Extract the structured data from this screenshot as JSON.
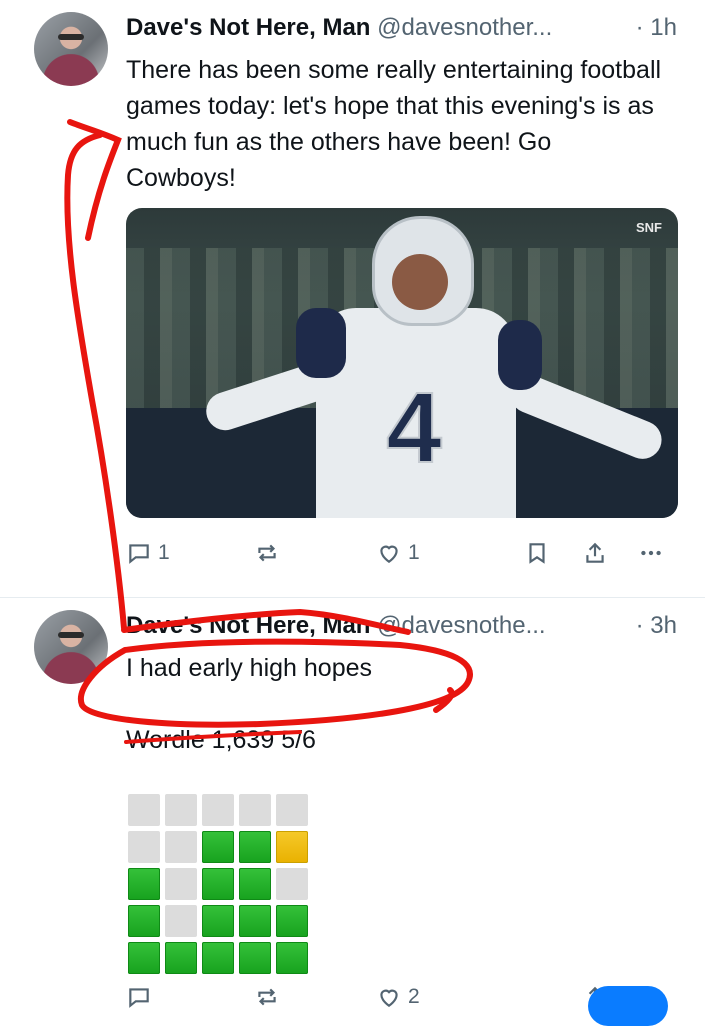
{
  "posts": [
    {
      "author_name": "Dave's Not Here, Man",
      "handle": "@davesnother...",
      "time": "· 1h",
      "text": "There has been some really entertaining football games today: let's hope that this evening's is as much fun as the others have been! Go Cowboys!",
      "media": {
        "jersey_number": "4",
        "network_bug": "SNF"
      },
      "actions": {
        "reply_count": "1",
        "repost_count": "",
        "like_count": "1"
      }
    },
    {
      "author_name": "Dave's Not Here, Man",
      "handle": "@davesnothe...",
      "time": "· 3h",
      "text": "I had early high hopes",
      "wordle_line": "Wordle 1,639 5/6",
      "wordle_rows": [
        [
          "x",
          "x",
          "x",
          "x",
          "x"
        ],
        [
          "x",
          "x",
          "g",
          "g",
          "y"
        ],
        [
          "g",
          "x",
          "g",
          "g",
          "x"
        ],
        [
          "g",
          "x",
          "g",
          "g",
          "g"
        ],
        [
          "g",
          "g",
          "g",
          "g",
          "g"
        ]
      ],
      "actions": {
        "like_count": "2"
      }
    }
  ],
  "icons": [
    "reply-icon",
    "repost-icon",
    "like-icon",
    "bookmark-icon",
    "share-icon",
    "more-icon"
  ],
  "colors": {
    "annotation": "#e8150f",
    "wordle_green": "#17a21e",
    "wordle_yellow": "#e9b100",
    "muted": "#536471"
  }
}
